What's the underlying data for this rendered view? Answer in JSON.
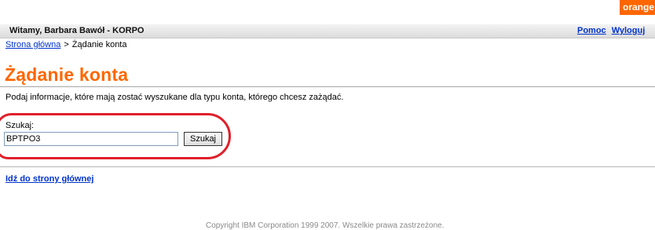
{
  "brand": {
    "text": "orange",
    "color": "#ff6600"
  },
  "topbar": {
    "welcome": "Witamy, Barbara Bawół - KORPO",
    "links": [
      "Pomoc",
      "Wyloguj"
    ]
  },
  "breadcrumb": {
    "home": "Strona główna",
    "separator": ">",
    "current": "Żądanie konta"
  },
  "page": {
    "title": "Żądanie konta",
    "description": "Podaj informacje, które mają zostać wyszukane dla typu konta, którego chcesz zażądać."
  },
  "search": {
    "label": "Szukaj:",
    "value": "BPTPO3",
    "button": "Szukaj"
  },
  "home_link": "Idź do strony głównej",
  "footer": {
    "copyright": "Copyright IBM Corporation 1999 2007. Wszelkie prawa zastrzeżone."
  },
  "colors": {
    "accent": "#ff6600",
    "link": "#0033cc",
    "annotation": "#e0202a"
  }
}
